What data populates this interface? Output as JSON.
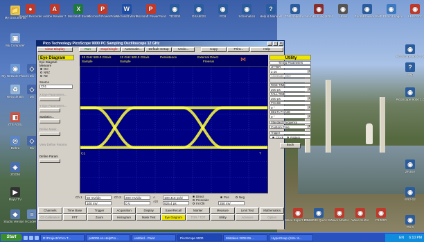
{
  "desktop": {
    "icons_left": [
      {
        "label": "My Documents",
        "glyph": "📁",
        "color": "#e6c34a"
      },
      {
        "label": "My Computer",
        "glyph": "▣",
        "color": "#7aa0d8"
      },
      {
        "label": "My Network Places",
        "glyph": "◉",
        "color": "#6b9ad6"
      },
      {
        "label": "Recycle Bin",
        "glyph": "♻",
        "color": "#8fb3d9"
      },
      {
        "label": "ZTE ADSL",
        "glyph": "◧",
        "color": "#cc5544"
      },
      {
        "label": "Debra",
        "glyph": "◎",
        "color": "#5a86c8"
      },
      {
        "label": "ZOOM",
        "glyph": "◈",
        "color": "#4a6fb0"
      },
      {
        "label": "RayV TV",
        "glyph": "▶",
        "color": "#333"
      },
      {
        "label": "Studio Version 9",
        "glyph": "◆",
        "color": "#5577aa"
      }
    ],
    "icons_left2": [
      {
        "label": "Div",
        "glyph": "◇",
        "color": "#4466aa"
      },
      {
        "label": "Div",
        "glyph": "◇",
        "color": "#4466aa"
      },
      {
        "label": "Div",
        "glyph": "◇",
        "color": "#4466aa"
      },
      {
        "label": "Codes",
        "glyph": "≡",
        "color": "#6688bb"
      }
    ],
    "icons_top": [
      {
        "label": "Sound Recorder",
        "glyph": "●",
        "color": "#c0392b"
      },
      {
        "label": "Adobe Reader 7",
        "glyph": "A",
        "color": "#c0392b"
      },
      {
        "label": "Microsoft Excel",
        "glyph": "X",
        "color": "#1e7a3a"
      },
      {
        "label": "Microsoft PowerPoint",
        "glyph": "P",
        "color": "#c0392b"
      },
      {
        "label": "Microsoft Word",
        "glyph": "W",
        "color": "#1f4fa8"
      },
      {
        "label": "Microsoft PowerPoint",
        "glyph": "P",
        "color": "#c0392b"
      },
      {
        "label": "TD3000",
        "glyph": "◉",
        "color": "#2a5d9f"
      },
      {
        "label": "OSA8023",
        "glyph": "◉",
        "color": "#2a5d9f"
      },
      {
        "label": "PCB",
        "glyph": "◉",
        "color": "#2a5d9f"
      },
      {
        "label": "Schematics",
        "glyph": "◉",
        "color": "#2a5d9f"
      },
      {
        "label": "Help & Manuals",
        "glyph": "?",
        "color": "#2a5d9f"
      },
      {
        "label": "TDR Impeda...",
        "glyph": "◉",
        "color": "#2a5d9f"
      },
      {
        "label": "Nero Burning ROM",
        "glyph": "◉",
        "color": "#8b2b2b"
      },
      {
        "label": "eRule",
        "glyph": "◉",
        "color": "#555"
      },
      {
        "label": "ZoomBrowser EX",
        "glyph": "◉",
        "color": "#2a5d9f"
      },
      {
        "label": "HP Photo Imagin...",
        "glyph": "◉",
        "color": "#3a7ac2"
      },
      {
        "label": "LEGO20c",
        "glyph": "◉",
        "color": "#c0392b"
      }
    ],
    "icons_right": [
      {
        "label": "PicoScope 9000 1.2",
        "glyph": "◉",
        "color": "#2a5d9f"
      },
      {
        "label": "Help",
        "glyph": "?",
        "color": "#2a5d9f"
      },
      {
        "label": "PicoScope 9000 1.0",
        "glyph": "◉",
        "color": "#2a5d9f"
      },
      {
        "label": "ZF3SA",
        "glyph": "◉",
        "color": "#2a5d9f"
      },
      {
        "label": "ER2-02",
        "glyph": "◉",
        "color": "#2a5d9f"
      },
      {
        "label": "PS 6",
        "glyph": "◉",
        "color": "#2a5d9f"
      }
    ],
    "icons_bottom": [
      {
        "label": "Wave Expert 100H",
        "glyph": "◉",
        "color": "#c0392b"
      },
      {
        "label": "OSA8030 Quick St...",
        "glyph": "◉",
        "color": "#2a5d9f"
      },
      {
        "label": "Wave Master",
        "glyph": "◉",
        "color": "#c0392b"
      },
      {
        "label": "Wave Surfer",
        "glyph": "◉",
        "color": "#c0392b"
      },
      {
        "label": "P10000",
        "glyph": "◉",
        "color": "#c0392b"
      }
    ]
  },
  "window": {
    "title": "Pico Technology  PicoScope 9000  PC Sampling Oscilloscope 12 GHz",
    "toolbar": [
      "Clear Display",
      "Run",
      "Stop/Single",
      "Autoscale...",
      "Default Setup",
      "Undo...",
      "Copy",
      "Print...",
      "Help"
    ],
    "left_panel": {
      "title": "Eye Diagram",
      "measure_label": "Eye Diagram",
      "measure_heading": "Measure",
      "measure_options": [
        "OH",
        "NRZ",
        "RZ"
      ],
      "source_label": "Source",
      "source_value": "Ch1",
      "x_label": "X Eye Parameters...",
      "y_label": "Y Eye Parameters...",
      "stats_label": "Statistics...",
      "mask_label": "Define Mask...",
      "display_label": "View Define Params",
      "define_param": "Define Param"
    },
    "scope": {
      "head_left1": "12 GHz  500.0 GSa/s",
      "head_left2": "Sample",
      "head_mid1": "12 GHz  500.0 GSa/s",
      "head_mid2": "Sample",
      "head_mode": "Persistence",
      "head_trig1": "External Direct",
      "head_trig2": "Freerun",
      "ch_marker": "C1",
      "trig_marker": "T"
    },
    "right_panel": {
      "title": "Utility",
      "subtitle": "Timing Parameters",
      "fields": [
        {
          "label": "JITTER",
          "value": "2 ps"
        },
        {
          "label": "RISE TIME",
          "value": "200 ps"
        },
        {
          "label": "FALL TIME",
          "value": "200 ps"
        },
        {
          "label": "PHASE",
          "value": "0 °"
        },
        {
          "label": "DELTA PHASE",
          "value": "0 °"
        }
      ],
      "dis_label": "Amplitude Jitter",
      "standard_label": "Standard Frequency",
      "standard_value": "Custom Freq",
      "trigger_label": "Trigger",
      "trigger_opts": [
        "Clock",
        "Pattern"
      ],
      "back": "Back"
    },
    "bottom": {
      "ch1_label": "Ch 1",
      "ch1_scale": "50 mV/div",
      "ch1_offset": "100 mV",
      "ch2_label": "Ch 2",
      "ch2_scale": "200 mV/div",
      "ch2_offset": "0 V",
      "timebase": "100.416 ps/d",
      "delay": "926.4 ps",
      "trig_level": "250 mV",
      "trig_opts": [
        "Direct",
        "Prescaler",
        "Int Clk"
      ],
      "slope": [
        "Pos",
        "Neg"
      ],
      "tabs_row1": [
        "Channels",
        "Time Base",
        "Trigger",
        "Acquisition",
        "Display",
        "Save/Recall",
        "Marker",
        "Measure",
        "Limit Test",
        "Mathematics"
      ],
      "tabs_row2": [
        "Ch Calibration",
        "FFT",
        "Zoom",
        "Histogram",
        "Mask Test",
        "Eye Diagram",
        "TDR / TDT",
        "Utility",
        "Advance",
        "Option"
      ]
    }
  },
  "taskbar": {
    "start": "Start",
    "tasks": [
      "D:\\Projects\\Pico T...",
      "ps9000.en.HelpPro...",
      "untitled - Paint",
      "PicoScope 9000",
      "Mistakes 2008.06....",
      "HyperSnap (Size: 6..."
    ],
    "active_index": 3,
    "lang": "EN",
    "clock": "6:10 PM"
  },
  "colors": {
    "trace": "#ffff40",
    "plot_bg": "#000082",
    "grid": "#5a5aff",
    "tab_active": "#efe600"
  }
}
